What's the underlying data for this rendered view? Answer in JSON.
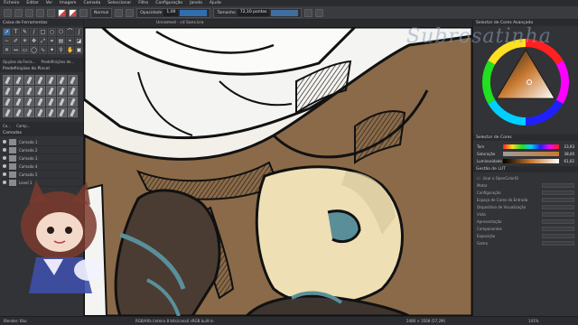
{
  "menu": [
    "Ficheiro",
    "Editar",
    "Ver",
    "Imagem",
    "Camada",
    "Seleccionar",
    "Filtro",
    "Configuração",
    "Janela",
    "Ajuda"
  ],
  "toolbar": {
    "blend_mode": "Normal",
    "opacity_label": "Opacidade",
    "opacity_value": "1,00",
    "size_label": "Tamanho",
    "size_value": "72,10 pontos"
  },
  "left_dock": {
    "toolbox_title": "Caixa de Ferramentas",
    "tabs": [
      "Opções da Ferra...",
      "Predefinições de..."
    ],
    "brush_presets_title": "Predefinições do Pincel",
    "layers_tabs": [
      "Ca...",
      "Camp..."
    ],
    "layers_title": "Camadas",
    "layers": [
      "Camada 1",
      "Camada 2",
      "Camada 3",
      "Camada 4",
      "Camada 5",
      "Level 1"
    ]
  },
  "canvas": {
    "doc_tab": "Unnamed - cd Sans.kra"
  },
  "right_dock": {
    "selector_title": "Selector de Cores Avançado",
    "colours_title": "Selector de Cores",
    "hsv": [
      {
        "label": "Tom",
        "value": "23,93"
      },
      {
        "label": "Saturação",
        "value": "38,00"
      },
      {
        "label": "Luminosidade",
        "value": "61,02"
      }
    ],
    "lut_title": "Gestão de LUT",
    "lut_checkbox": "Usar o OpenColorIO",
    "properties": [
      "Motor",
      "Configuração",
      "Espaço de Cores da Entrada",
      "Dispositivo de Visualização",
      "Vista",
      "Apresentação",
      "Componentes",
      "Exposição",
      "Gama"
    ]
  },
  "status": {
    "brush": "Blender: Blur",
    "colorspace": "RGB/Alfa (inteiro 8 bits/canal)  sRGB built-in",
    "dimensions": "2480 × 3508 (57,2M)",
    "zoom": "141%"
  },
  "watermark": "Subrosatinha",
  "colors": {
    "accent": "#3a6ea5",
    "artwork_brown": "#8a6a48",
    "artwork_skin": "#eedfb4",
    "artwork_hair": "#4a3c33",
    "artwork_teal": "#5a8f9a"
  }
}
